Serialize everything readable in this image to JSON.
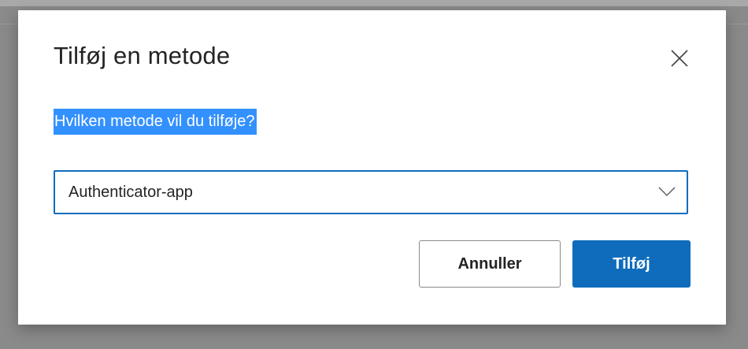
{
  "dialog": {
    "title": "Tilføj en metode",
    "close_icon": "close-icon",
    "question": "Hvilken metode vil du tilføje?",
    "method_select": {
      "selected_value": "Authenticator-app",
      "icon": "chevron-down-icon"
    },
    "cancel_label": "Annuller",
    "add_label": "Tilføj"
  },
  "colors": {
    "accent": "#0f6cbd",
    "selection_highlight": "#3390ff",
    "backdrop": "#8a8a8a",
    "text": "#242424"
  }
}
